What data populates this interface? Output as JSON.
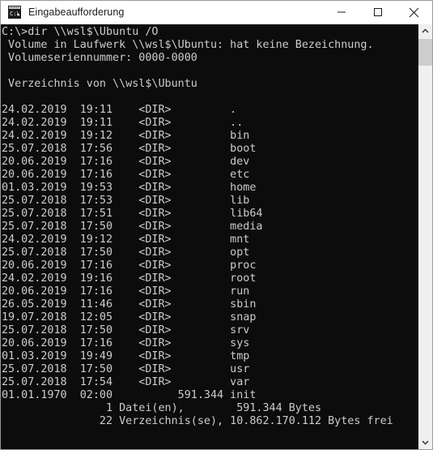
{
  "window": {
    "title": "Eingabeaufforderung",
    "icon": "cmd-console-icon",
    "background_color": "#0c0c0c",
    "text_color": "#cccccc",
    "titlebar_color": "#ffffff",
    "controls": {
      "minimize_label": "Minimieren",
      "maximize_label": "Maximieren",
      "close_label": "Schließen"
    }
  },
  "scrollbar": {
    "up_arrow_label": "Nach oben scrollen",
    "down_arrow_label": "Nach unten scrollen",
    "thumb_label": "Bildlauffeld",
    "thumb_color": "#cdcdcd",
    "track_color": "#f0f0f0"
  },
  "console": {
    "prompt_line": "C:\\>dir \\\\wsl$\\Ubuntu /O",
    "volume_line": " Volume in Laufwerk \\\\wsl$\\Ubuntu: hat keine Bezeichnung.",
    "serial_line": " Volumeseriennummer: 0000-0000",
    "directory_line": " Verzeichnis von \\\\wsl$\\Ubuntu",
    "entries": [
      {
        "date": "24.02.2019",
        "time": "19:11",
        "type": "<DIR>",
        "size": "",
        "name": "."
      },
      {
        "date": "24.02.2019",
        "time": "19:11",
        "type": "<DIR>",
        "size": "",
        "name": ".."
      },
      {
        "date": "24.02.2019",
        "time": "19:12",
        "type": "<DIR>",
        "size": "",
        "name": "bin"
      },
      {
        "date": "25.07.2018",
        "time": "17:56",
        "type": "<DIR>",
        "size": "",
        "name": "boot"
      },
      {
        "date": "20.06.2019",
        "time": "17:16",
        "type": "<DIR>",
        "size": "",
        "name": "dev"
      },
      {
        "date": "20.06.2019",
        "time": "17:16",
        "type": "<DIR>",
        "size": "",
        "name": "etc"
      },
      {
        "date": "01.03.2019",
        "time": "19:53",
        "type": "<DIR>",
        "size": "",
        "name": "home"
      },
      {
        "date": "25.07.2018",
        "time": "17:53",
        "type": "<DIR>",
        "size": "",
        "name": "lib"
      },
      {
        "date": "25.07.2018",
        "time": "17:51",
        "type": "<DIR>",
        "size": "",
        "name": "lib64"
      },
      {
        "date": "25.07.2018",
        "time": "17:50",
        "type": "<DIR>",
        "size": "",
        "name": "media"
      },
      {
        "date": "24.02.2019",
        "time": "19:12",
        "type": "<DIR>",
        "size": "",
        "name": "mnt"
      },
      {
        "date": "25.07.2018",
        "time": "17:50",
        "type": "<DIR>",
        "size": "",
        "name": "opt"
      },
      {
        "date": "20.06.2019",
        "time": "17:16",
        "type": "<DIR>",
        "size": "",
        "name": "proc"
      },
      {
        "date": "24.02.2019",
        "time": "19:16",
        "type": "<DIR>",
        "size": "",
        "name": "root"
      },
      {
        "date": "20.06.2019",
        "time": "17:16",
        "type": "<DIR>",
        "size": "",
        "name": "run"
      },
      {
        "date": "26.05.2019",
        "time": "11:46",
        "type": "<DIR>",
        "size": "",
        "name": "sbin"
      },
      {
        "date": "19.07.2018",
        "time": "12:05",
        "type": "<DIR>",
        "size": "",
        "name": "snap"
      },
      {
        "date": "25.07.2018",
        "time": "17:50",
        "type": "<DIR>",
        "size": "",
        "name": "srv"
      },
      {
        "date": "20.06.2019",
        "time": "17:16",
        "type": "<DIR>",
        "size": "",
        "name": "sys"
      },
      {
        "date": "01.03.2019",
        "time": "19:49",
        "type": "<DIR>",
        "size": "",
        "name": "tmp"
      },
      {
        "date": "25.07.2018",
        "time": "17:50",
        "type": "<DIR>",
        "size": "",
        "name": "usr"
      },
      {
        "date": "25.07.2018",
        "time": "17:54",
        "type": "<DIR>",
        "size": "",
        "name": "var"
      },
      {
        "date": "01.01.1970",
        "time": "02:00",
        "type": "",
        "size": "591.344",
        "name": "init"
      }
    ],
    "summary_files": "                1 Datei(en),        591.344 Bytes",
    "summary_dirs": "               22 Verzeichnis(se), 10.862.170.112 Bytes frei",
    "file_count": "1",
    "file_bytes": "591.344",
    "dir_count": "22",
    "free_bytes": "10.862.170.112"
  }
}
